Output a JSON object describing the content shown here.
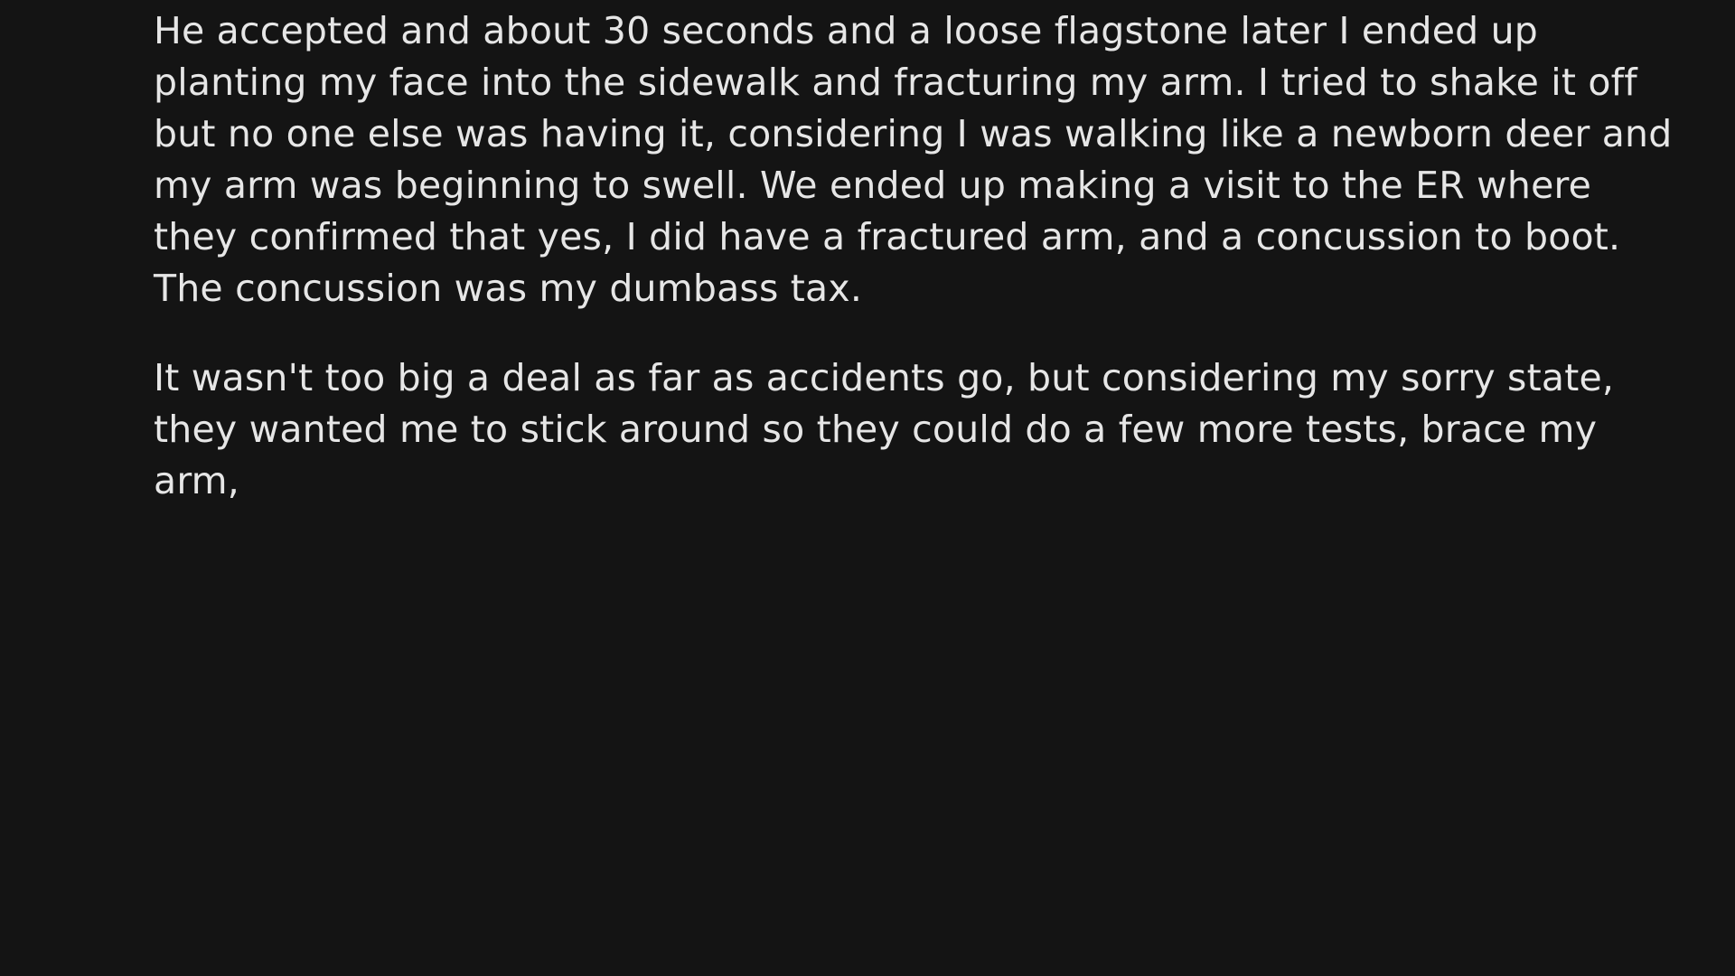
{
  "story": {
    "paragraphs": [
      "He accepted and about 30 seconds and a loose flagstone later I ended up\nplanting my face into the sidewalk and fracturing my arm. I tried to shake it off\nbut no one else was having it, considering I was walking like a newborn deer and\nmy arm was beginning to swell. We ended up making a visit to the ER where\nthey confirmed that yes, I did have a fractured arm, and a concussion to boot.\nThe concussion was my dumbass tax.",
      "It wasn't too big a deal as far as accidents go, but considering my sorry state,\nthey wanted me to stick around so they could do a few more tests, brace my\narm,"
    ]
  },
  "colors": {
    "background": "#141414",
    "text": "#e6e6e6"
  }
}
